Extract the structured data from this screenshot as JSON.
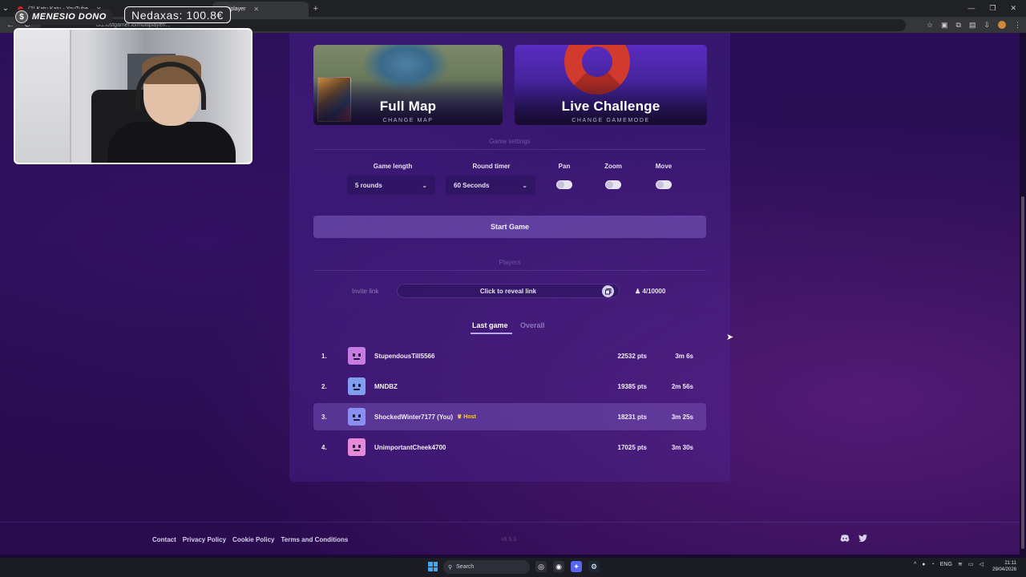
{
  "browser": {
    "tabs": [
      {
        "title": "(2) Katu Katu - YouTube",
        "active": false
      },
      {
        "title": "Multiplayer",
        "active": true
      }
    ],
    "url": "old.lostgamer.io/multiplayer/..."
  },
  "overlay": {
    "donation_label": "MENESIO DONO",
    "donation_amount": "Nedaxas: 100.8€"
  },
  "game": {
    "map_card": {
      "title": "Full Map",
      "subtitle": "CHANGE MAP"
    },
    "mode_card": {
      "title": "Live Challenge",
      "subtitle": "CHANGE GAMEMODE"
    },
    "settings_heading": "Game settings",
    "settings": {
      "game_length": {
        "label": "Game length",
        "value": "5 rounds"
      },
      "round_timer": {
        "label": "Round timer",
        "value": "60 Seconds"
      },
      "pan": {
        "label": "Pan",
        "enabled": false
      },
      "zoom": {
        "label": "Zoom",
        "enabled": false
      },
      "move": {
        "label": "Move",
        "enabled": false
      }
    },
    "start_button": "Start Game",
    "players_heading": "Players",
    "invite": {
      "label": "Invite link",
      "reveal_text": "Click to reveal link",
      "player_count": "4/10000"
    },
    "leaderboard": {
      "tabs": [
        "Last game",
        "Overall"
      ],
      "active_tab": "Last game",
      "rows": [
        {
          "rank": "1.",
          "name": "StupendousTill5566",
          "badge": "",
          "points": "22532 pts",
          "time": "3m 6s",
          "avatar_color": "#c77ae0",
          "highlight": false
        },
        {
          "rank": "2.",
          "name": "MNDBZ",
          "badge": "",
          "points": "19385 pts",
          "time": "2m 56s",
          "avatar_color": "#7f9ef2",
          "highlight": false
        },
        {
          "rank": "3.",
          "name": "ShockedWinter7177 (You)",
          "badge": "Host",
          "points": "18231 pts",
          "time": "3m 25s",
          "avatar_color": "#8a8ef0",
          "highlight": true
        },
        {
          "rank": "4.",
          "name": "UnimportantCheek4700",
          "badge": "",
          "points": "17025 pts",
          "time": "3m 30s",
          "avatar_color": "#e48ad8",
          "highlight": false
        }
      ]
    }
  },
  "footer": {
    "links": [
      "Contact",
      "Privacy Policy",
      "Cookie Policy",
      "Terms and Conditions"
    ],
    "version": "v6.5.3"
  },
  "taskbar": {
    "search_placeholder": "Search",
    "language": "ENG",
    "time": "21:11",
    "date": "29/04/2026"
  }
}
